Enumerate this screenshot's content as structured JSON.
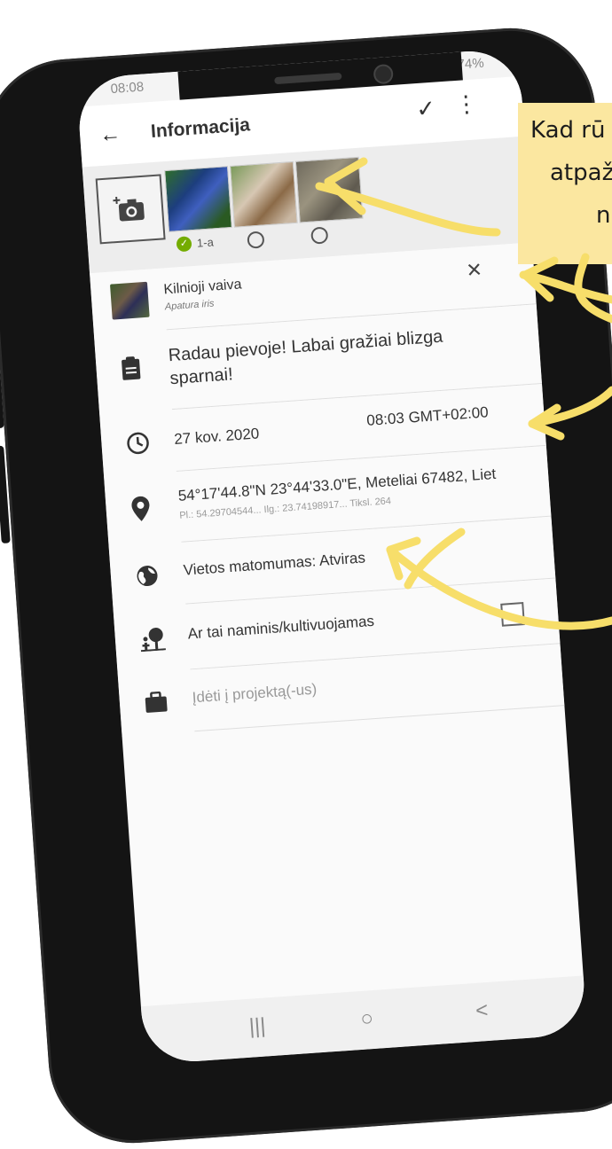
{
  "status_bar": {
    "time": "08:08",
    "signal": "74%"
  },
  "app_bar": {
    "back": "←",
    "title": "Informacija",
    "confirm": "✓",
    "more": "⋮"
  },
  "photos": {
    "selected_label": "1-a"
  },
  "taxon": {
    "common_name": "Kilnioji vaiva",
    "scientific_name": "Apatura iris",
    "remove": "✕"
  },
  "notes": {
    "text_line1": "Radau pievoje! Labai gražiai blizga",
    "text_line2": "sparnai!"
  },
  "datetime": {
    "date": "27 kov. 2020",
    "time": "08:03 GMT+02:00"
  },
  "location": {
    "coords": "54°17'44.8\"N 23°44'33.0\"E, Meteliai 67482, Liet",
    "details": "Pl.: 54.29704544... Ilg.: 23.74198917... Tiksl. 264"
  },
  "visibility": {
    "text": "Vietos matomumas: Atviras"
  },
  "captive": {
    "text": "Ar tai naminis/kultivuojamas"
  },
  "project": {
    "placeholder": "Įdėti į projektą(-us)"
  },
  "nav": {
    "recent": "|||",
    "home": "○",
    "back": "<"
  },
  "callout": {
    "line1": "Kad rū",
    "line2": "atpaž",
    "line3": "n"
  },
  "colors": {
    "accent_green": "#74ac00",
    "callout_bg": "#fbe7a0",
    "arrow": "#f7de6a"
  }
}
